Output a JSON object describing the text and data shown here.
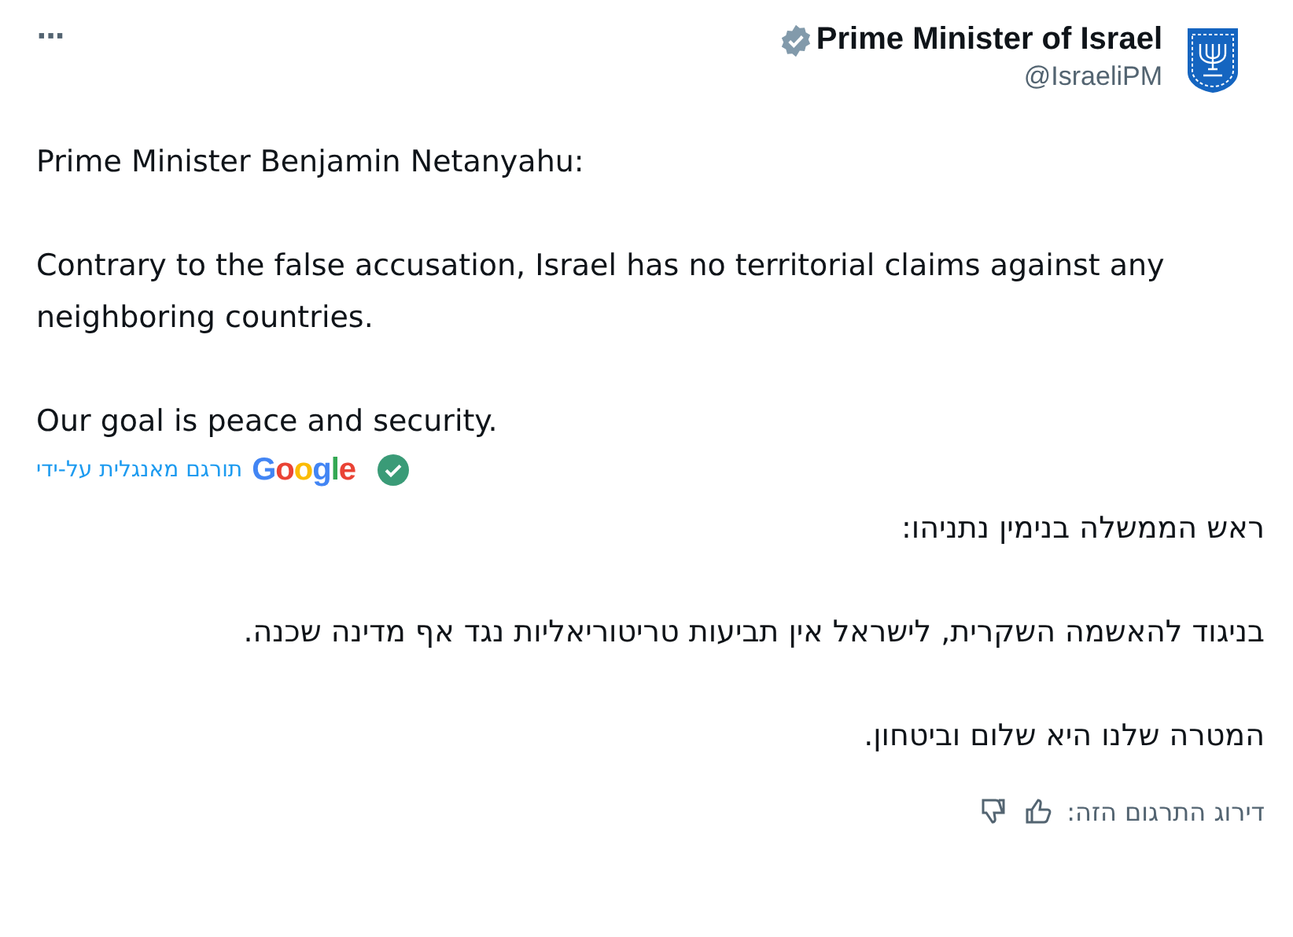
{
  "tweet": {
    "more": "···",
    "author": {
      "name": "Prime Minister of Israel",
      "handle": "@IsraeliPM",
      "verified": true
    },
    "paragraphs": [
      "Prime Minister Benjamin Netanyahu:",
      "Contrary to the false accusation, Israel has no territorial claims against any neighboring countries.",
      "Our goal is peace and security."
    ],
    "translation": {
      "label": "תורגם מאנגלית על-ידי",
      "provider": "Google",
      "paragraphs": [
        "ראש הממשלה בנימין נתניהו:",
        "בניגוד להאשמה השקרית, לישראל אין תביעות טריטוריאליות נגד אף מדינה שכנה.",
        "המטרה שלנו היא שלום וביטחון."
      ],
      "rate_label": "דירוג התרגום הזה:"
    }
  }
}
